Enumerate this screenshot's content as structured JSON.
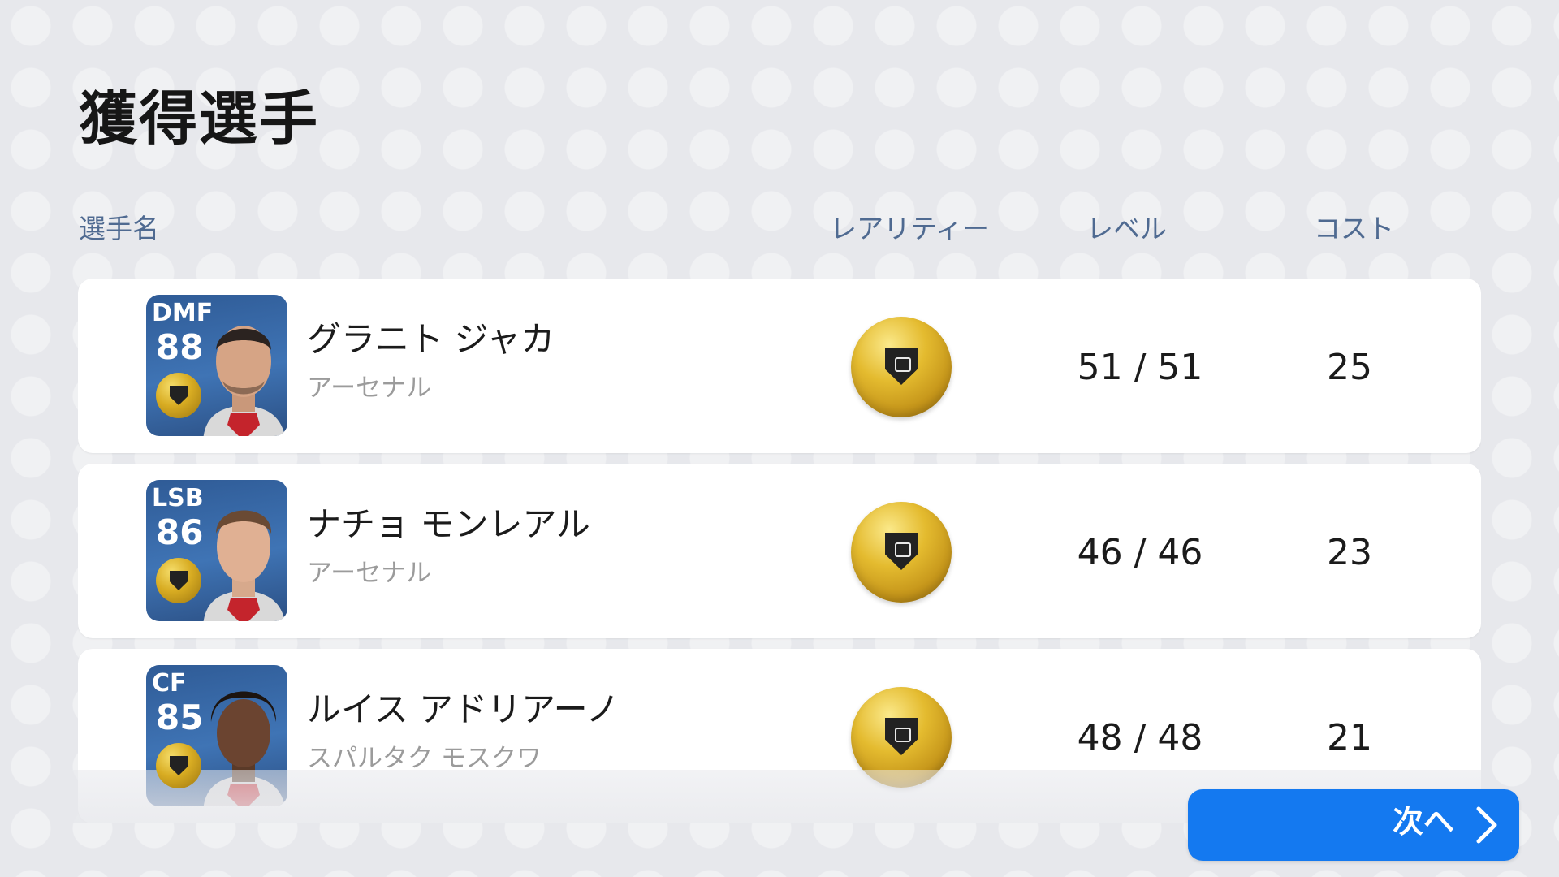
{
  "page": {
    "title": "獲得選手"
  },
  "columns": {
    "name": "選手名",
    "rarity": "レアリティー",
    "level": "レベル",
    "cost": "コスト"
  },
  "players": [
    {
      "position": "DMF",
      "overall": "88",
      "name": "グラニト ジャカ",
      "club": "アーセナル",
      "rarity": "gold-coin",
      "level": "51 / 51",
      "cost": "25"
    },
    {
      "position": "LSB",
      "overall": "86",
      "name": "ナチョ モンレアル",
      "club": "アーセナル",
      "rarity": "gold-coin",
      "level": "46 / 46",
      "cost": "23"
    },
    {
      "position": "CF",
      "overall": "85",
      "name": "ルイス アドリアーノ",
      "club": "スパルタク モスクワ",
      "rarity": "gold-coin",
      "level": "48 / 48",
      "cost": "21"
    }
  ],
  "footer": {
    "next_label": "次へ",
    "next_icon": "chevron-right-icon"
  },
  "colors": {
    "accent_blue": "#1479f0",
    "header_text": "#4f6a91",
    "background": "#e7e8ec"
  }
}
